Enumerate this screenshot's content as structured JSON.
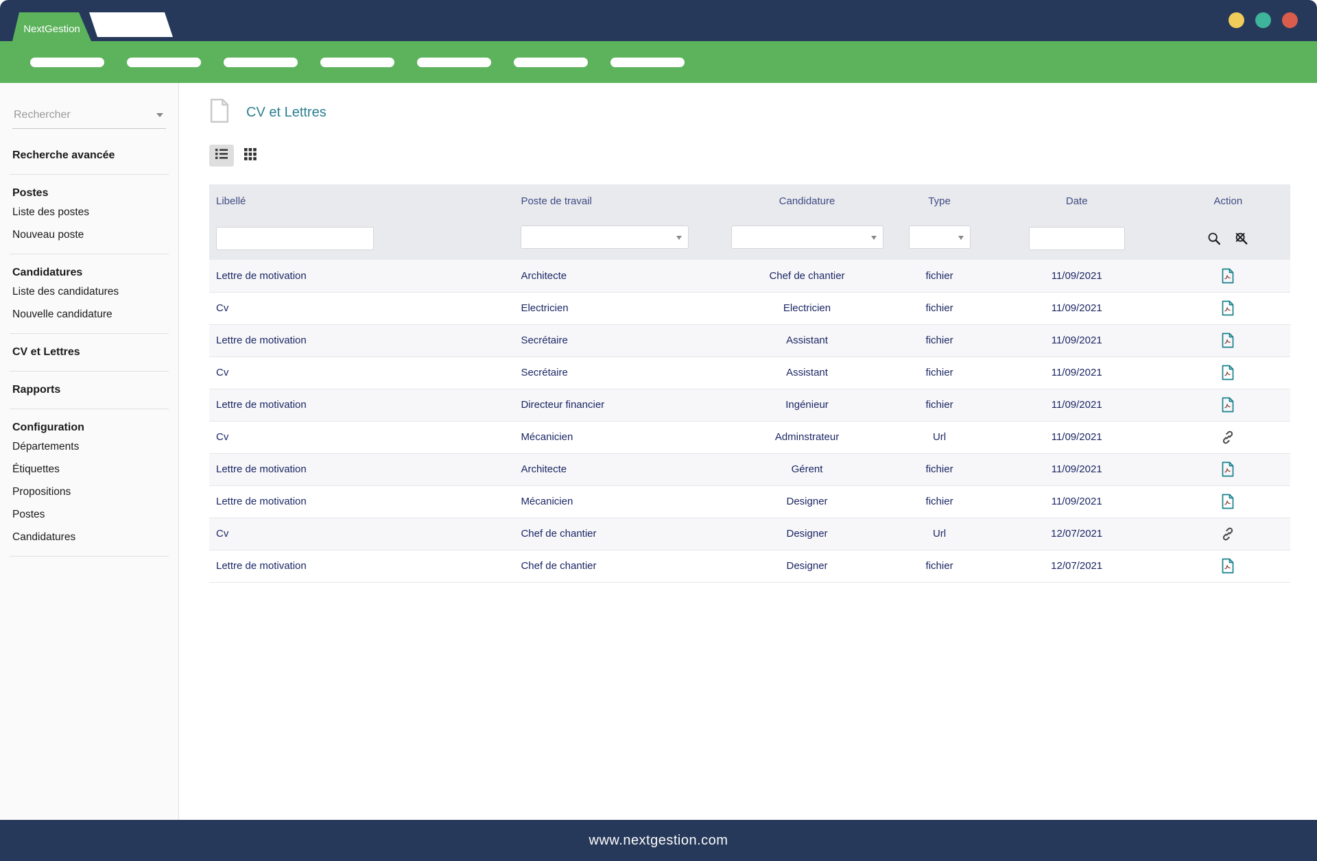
{
  "brand": {
    "logo_text": "NextGestion",
    "window_controls": [
      {
        "name": "minimize",
        "color": "#f0cd5a"
      },
      {
        "name": "restore",
        "color": "#3eb49b"
      },
      {
        "name": "close",
        "color": "#d95c4c"
      }
    ]
  },
  "nav": {
    "pill_count": 7
  },
  "sidebar": {
    "search_placeholder": "Rechercher",
    "sections": [
      {
        "title": "Recherche avancée",
        "link": true,
        "items": []
      },
      {
        "title": "Postes",
        "link": false,
        "items": [
          "Liste des postes",
          "Nouveau poste"
        ]
      },
      {
        "title": "Candidatures",
        "link": false,
        "items": [
          "Liste des candidatures",
          "Nouvelle candidature"
        ]
      },
      {
        "title": "CV et Lettres",
        "link": true,
        "items": []
      },
      {
        "title": "Rapports",
        "link": true,
        "items": []
      },
      {
        "title": "Configuration",
        "link": false,
        "items": [
          "Départements",
          "Étiquettes",
          "Propositions",
          "Postes",
          "Candidatures"
        ]
      }
    ]
  },
  "main": {
    "page_title": "CV et Lettres",
    "view_toggles": [
      "list-view",
      "grid-view"
    ],
    "active_view": "list-view",
    "table": {
      "columns": [
        {
          "label": "Libellé",
          "filter": "text",
          "align": "left"
        },
        {
          "label": "Poste de travail",
          "filter": "select",
          "align": "left"
        },
        {
          "label": "Candidature",
          "filter": "select",
          "align": "center"
        },
        {
          "label": "Type",
          "filter": "select",
          "align": "center"
        },
        {
          "label": "Date",
          "filter": "text",
          "align": "center"
        },
        {
          "label": "Action",
          "filter": "icons",
          "align": "center"
        }
      ],
      "rows": [
        {
          "libelle": "Lettre de motivation",
          "poste": "Architecte",
          "candidature": "Chef de chantier",
          "type": "fichier",
          "date": "11/09/2021",
          "action": "pdf"
        },
        {
          "libelle": "Cv",
          "poste": "Electricien",
          "candidature": "Electricien",
          "type": "fichier",
          "date": "11/09/2021",
          "action": "pdf"
        },
        {
          "libelle": "Lettre de motivation",
          "poste": "Secrétaire",
          "candidature": "Assistant",
          "type": "fichier",
          "date": "11/09/2021",
          "action": "pdf"
        },
        {
          "libelle": "Cv",
          "poste": "Secrétaire",
          "candidature": "Assistant",
          "type": "fichier",
          "date": "11/09/2021",
          "action": "pdf"
        },
        {
          "libelle": "Lettre de motivation",
          "poste": "Directeur financier",
          "candidature": "Ingénieur",
          "type": "fichier",
          "date": "11/09/2021",
          "action": "pdf"
        },
        {
          "libelle": "Cv",
          "poste": "Mécanicien",
          "candidature": "Adminstrateur",
          "type": "Url",
          "date": "11/09/2021",
          "action": "link"
        },
        {
          "libelle": "Lettre de motivation",
          "poste": "Architecte",
          "candidature": "Gérent",
          "type": "fichier",
          "date": "11/09/2021",
          "action": "pdf"
        },
        {
          "libelle": "Lettre de motivation",
          "poste": "Mécanicien",
          "candidature": "Designer",
          "type": "fichier",
          "date": "11/09/2021",
          "action": "pdf"
        },
        {
          "libelle": "Cv",
          "poste": "Chef de chantier",
          "candidature": "Designer",
          "type": "Url",
          "date": "12/07/2021",
          "action": "link"
        },
        {
          "libelle": "Lettre de motivation",
          "poste": "Chef de chantier",
          "candidature": "Designer",
          "type": "fichier",
          "date": "12/07/2021",
          "action": "pdf"
        }
      ]
    }
  },
  "footer": {
    "url": "www.nextgestion.com"
  },
  "colors": {
    "navy": "#26395a",
    "green": "#5cb35c",
    "teal_title": "#2b7f91",
    "pdf_icon": "#16808a",
    "header_label": "#3f4b82",
    "cell_text": "#1b2664"
  },
  "icons": {
    "action_pdf": "pdf-file-icon",
    "action_link": "link-icon",
    "filter_search": "search-icon",
    "filter_reset": "search-off-icon"
  }
}
